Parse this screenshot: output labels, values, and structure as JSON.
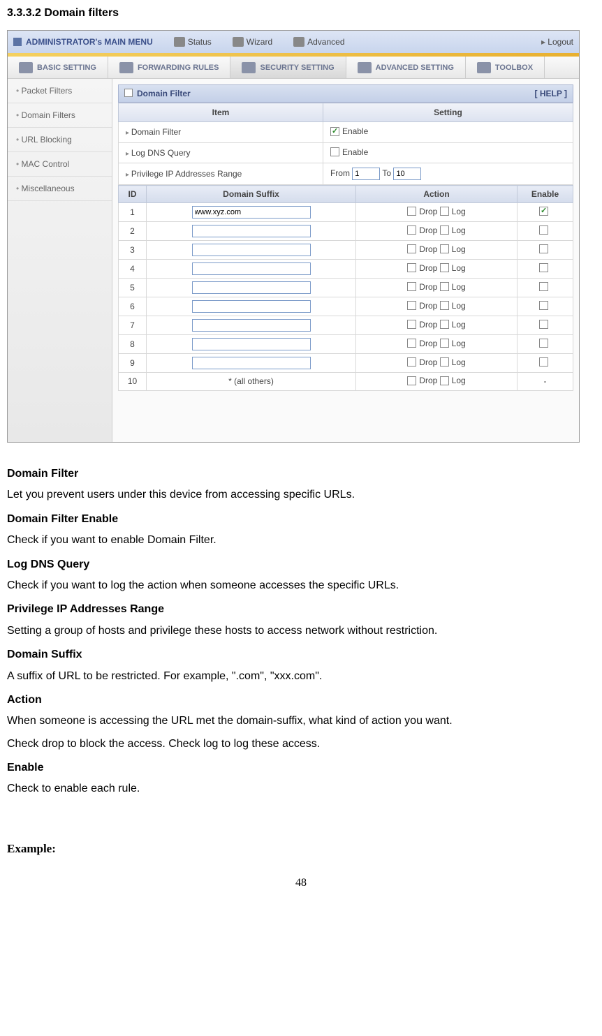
{
  "section_header": "3.3.3.2 Domain filters",
  "top_menu": {
    "admin_title": "ADMINISTRATOR's MAIN MENU",
    "items": [
      "Status",
      "Wizard",
      "Advanced"
    ],
    "logout": "Logout"
  },
  "sub_menu": {
    "items": [
      "BASIC SETTING",
      "FORWARDING RULES",
      "SECURITY SETTING",
      "ADVANCED SETTING",
      "TOOLBOX"
    ]
  },
  "sidebar": {
    "items": [
      "Packet Filters",
      "Domain Filters",
      "URL Blocking",
      "MAC Control",
      "Miscellaneous"
    ]
  },
  "panel": {
    "title": "Domain Filter",
    "help": "[ HELP ]"
  },
  "settings": {
    "col_item": "Item",
    "col_setting": "Setting",
    "row1_label": "Domain Filter",
    "row1_enable": "Enable",
    "row2_label": "Log DNS Query",
    "row2_enable": "Enable",
    "row3_label": "Privilege IP Addresses Range",
    "row3_from": "From",
    "row3_from_val": "1",
    "row3_to": "To",
    "row3_to_val": "10"
  },
  "filter": {
    "col_id": "ID",
    "col_suffix": "Domain Suffix",
    "col_action": "Action",
    "col_enable": "Enable",
    "drop": "Drop",
    "log": "Log",
    "all_others": "* (all others)",
    "row1_val": "www.xyz.com",
    "rows": [
      "1",
      "2",
      "3",
      "4",
      "5",
      "6",
      "7",
      "8",
      "9",
      "10"
    ]
  },
  "doc": {
    "h1": "Domain Filter",
    "p1": "Let you prevent users under this device from accessing specific URLs.",
    "h2": "Domain Filter Enable",
    "p2": "Check if you want to enable Domain Filter.",
    "h3": "Log DNS Query",
    "p3": "Check if you want to log the action when someone accesses the specific URLs.",
    "h4": "Privilege IP Addresses Range",
    "p4": "Setting a group of hosts and privilege these hosts to access network without restriction.",
    "h5": "Domain Suffix",
    "p5": "A suffix of URL to be restricted. For example, \".com\", \"xxx.com\".",
    "h6": "Action",
    "p6": "When someone is accessing the URL met the domain-suffix, what kind of action you want.",
    "p6b": "Check drop to block the access. Check log to log these access.",
    "h7": "Enable",
    "p7": "Check to enable each rule."
  },
  "example": "Example:",
  "page_num": "48"
}
